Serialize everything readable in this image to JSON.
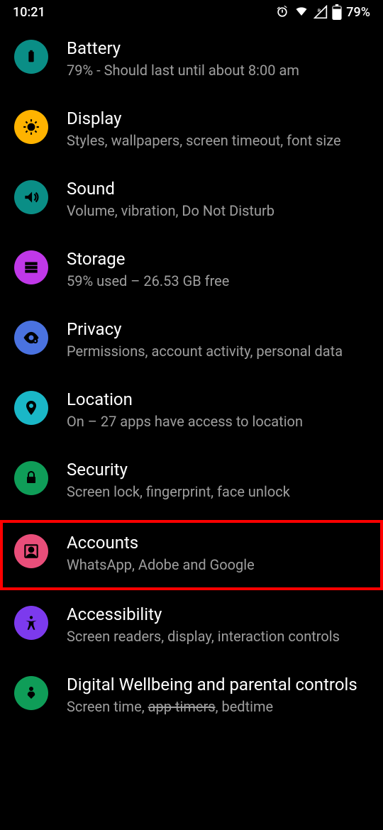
{
  "status": {
    "time": "10:21",
    "battery_text": "79%"
  },
  "icon_colors": {
    "battery": "#0a8e86",
    "display": "#ffb300",
    "sound": "#0a8e86",
    "storage": "#c038e8",
    "privacy": "#4a72e0",
    "location": "#1ab7c7",
    "security": "#0f9d58",
    "accounts": "#e94e7a",
    "accessibility": "#7c3aed",
    "wellbeing": "#0f9d58"
  },
  "items": {
    "battery": {
      "title": "Battery",
      "subtitle": "79% - Should last until about 8:00 am"
    },
    "display": {
      "title": "Display",
      "subtitle": "Styles, wallpapers, screen timeout, font size"
    },
    "sound": {
      "title": "Sound",
      "subtitle": "Volume, vibration, Do Not Disturb"
    },
    "storage": {
      "title": "Storage",
      "subtitle": "59% used – 26.53 GB free"
    },
    "privacy": {
      "title": "Privacy",
      "subtitle": "Permissions, account activity, personal data"
    },
    "location": {
      "title": "Location",
      "subtitle": "On – 27 apps have access to location"
    },
    "security": {
      "title": "Security",
      "subtitle": "Screen lock, fingerprint, face unlock"
    },
    "accounts": {
      "title": "Accounts",
      "subtitle": "WhatsApp, Adobe and Google"
    },
    "accessibility": {
      "title": "Accessibility",
      "subtitle": "Screen readers, display, interaction controls"
    },
    "wellbeing": {
      "title": "Digital Wellbeing and parental controls",
      "subtitle_pre": "Screen time, ",
      "subtitle_strike": "app timers",
      "subtitle_post": ", bedtime"
    }
  }
}
